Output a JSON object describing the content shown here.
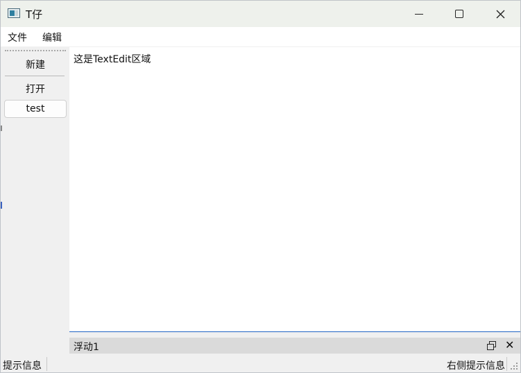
{
  "window": {
    "title": "T仔",
    "controls": {
      "minimize": "minimize-icon",
      "maximize": "maximize-icon",
      "close": "close-icon"
    }
  },
  "menubar": {
    "items": [
      {
        "label": "文件"
      },
      {
        "label": "编辑"
      }
    ]
  },
  "toolbar": {
    "items": [
      {
        "label": "新建"
      },
      {
        "label": "打开"
      },
      {
        "label": "test"
      }
    ]
  },
  "editor": {
    "content": "这是TextEdit区域"
  },
  "dock": {
    "title": "浮动1"
  },
  "statusbar": {
    "left": "提示信息",
    "right": "右侧提示信息"
  },
  "colors": {
    "accent": "#1f63c4",
    "titlebar": "#eef1ec",
    "dock_title": "#dadada"
  }
}
